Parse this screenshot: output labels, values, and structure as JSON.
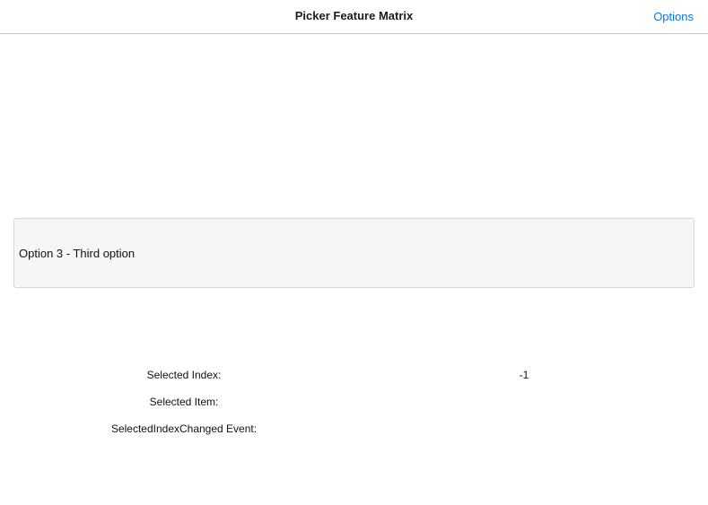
{
  "navbar": {
    "title": "Picker Feature Matrix",
    "options_label": "Options"
  },
  "picker": {
    "selected_text": "Option 3 - Third option"
  },
  "info": {
    "selected_index_label": "Selected Index:",
    "selected_index_value": "-1",
    "selected_item_label": "Selected Item:",
    "selected_item_value": "",
    "event_label": "SelectedIndexChanged Event:",
    "event_value": ""
  },
  "colors": {
    "accent": "#0a74e6",
    "picker_background": "#f6f6f6",
    "separator": "#c6c6c8"
  }
}
